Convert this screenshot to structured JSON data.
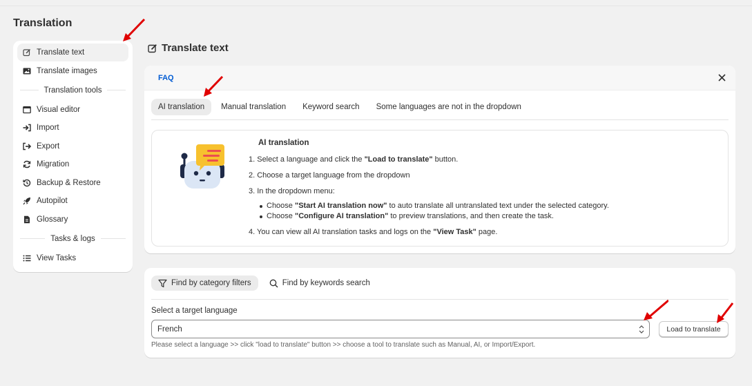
{
  "page_title": "Translation",
  "sidebar": {
    "items_top": [
      {
        "label": "Translate text",
        "icon": "edit-icon",
        "active": true
      },
      {
        "label": "Translate images",
        "icon": "image-icon"
      }
    ],
    "section_tools": "Translation tools",
    "items_tools": [
      {
        "label": "Visual editor",
        "icon": "window-icon"
      },
      {
        "label": "Import",
        "icon": "import-icon"
      },
      {
        "label": "Export",
        "icon": "export-icon"
      },
      {
        "label": "Migration",
        "icon": "refresh-icon"
      },
      {
        "label": "Backup & Restore",
        "icon": "history-icon"
      },
      {
        "label": "Autopilot",
        "icon": "rocket-icon"
      },
      {
        "label": "Glossary",
        "icon": "document-icon"
      }
    ],
    "section_tasks": "Tasks & logs",
    "items_tasks": [
      {
        "label": "View Tasks",
        "icon": "list-icon"
      }
    ]
  },
  "main": {
    "title": "Translate text",
    "faq": {
      "label": "FAQ",
      "tabs": [
        "AI translation",
        "Manual translation",
        "Keyword search",
        "Some languages are not in the dropdown"
      ],
      "active_tab": "AI translation",
      "info_title": "AI translation",
      "step1_pre": "1. Select a language and click the ",
      "step1_bold": "\"Load to translate\"",
      "step1_post": " button.",
      "step2": "2. Choose a target language from the dropdown",
      "step3": "3. In the dropdown menu:",
      "sub1_pre": "Choose ",
      "sub1_bold": "\"Start AI translation now\"",
      "sub1_post": " to auto translate all untranslated text under the selected category.",
      "sub2_pre": "Choose ",
      "sub2_bold": "\"Configure AI translation\"",
      "sub2_post": " to preview translations, and then create the task.",
      "step4_pre": "4. You can view all AI translation tasks and logs on the ",
      "step4_bold": "\"View Task\"",
      "step4_post": " page."
    },
    "filters": {
      "tabs": [
        {
          "label": "Find by category filters",
          "icon": "filter-icon",
          "active": true
        },
        {
          "label": "Find by keywords search",
          "icon": "search-icon"
        }
      ],
      "select_label": "Select a target language",
      "select_value": "French",
      "load_button": "Load to translate",
      "hint": "Please select a language >> click \"load to translate\" button >> choose a tool to translate such as Manual, AI, or Import/Export."
    }
  },
  "colors": {
    "accent_link": "#005bd3",
    "annotation_arrow": "#e00000",
    "page_bg": "#f1f1f1"
  }
}
